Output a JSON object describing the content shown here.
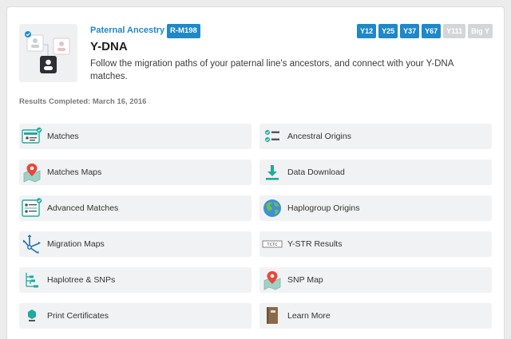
{
  "header": {
    "eyebrow": "Paternal Ancestry",
    "haplogroup_badge": "R-M198",
    "title": "Y-DNA",
    "description": "Follow the migration paths of your paternal line's ancestors, and connect with your Y-DNA matches.",
    "tests": [
      {
        "label": "Y12",
        "active": true
      },
      {
        "label": "Y25",
        "active": true
      },
      {
        "label": "Y37",
        "active": true
      },
      {
        "label": "Y67",
        "active": true
      },
      {
        "label": "Y111",
        "active": false
      },
      {
        "label": "Big Y",
        "active": false
      }
    ],
    "results_completed": "Results Completed: March 16, 2016"
  },
  "tiles": [
    {
      "label": "Matches",
      "icon": "matches-card-icon"
    },
    {
      "label": "Ancestral Origins",
      "icon": "checklist-icon"
    },
    {
      "label": "Matches Maps",
      "icon": "map-pin-icon"
    },
    {
      "label": "Data Download",
      "icon": "download-icon"
    },
    {
      "label": "Advanced Matches",
      "icon": "advanced-matches-icon"
    },
    {
      "label": "Haplogroup Origins",
      "icon": "globe-icon"
    },
    {
      "label": "Migration Maps",
      "icon": "migration-arrows-icon"
    },
    {
      "label": "Y-STR Results",
      "icon": "str-grid-icon"
    },
    {
      "label": "Haplotree & SNPs",
      "icon": "tree-icon"
    },
    {
      "label": "SNP Map",
      "icon": "snp-map-icon"
    },
    {
      "label": "Print Certificates",
      "icon": "certificate-icon"
    },
    {
      "label": "Learn More",
      "icon": "book-icon"
    }
  ],
  "colors": {
    "accent": "#1f88c9",
    "teal": "#1eaaa0",
    "tile_bg": "#f1f2f3",
    "inactive_badge": "#d3d6d9"
  }
}
